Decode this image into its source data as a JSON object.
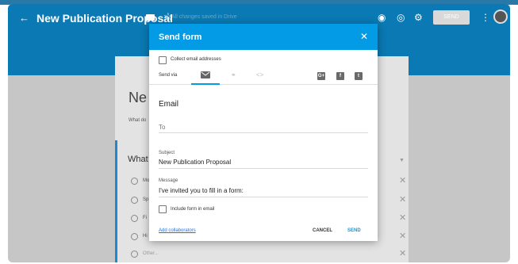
{
  "app": {
    "title": "New Publication Proposal",
    "save_status": "All changes saved in Drive",
    "send_button": "SEND"
  },
  "form": {
    "title": "New Publication Proposal",
    "title_visible": "Ne",
    "description_visible": "What do",
    "question_visible": "What",
    "options_visible": [
      "Mo",
      "Sp",
      "Fi",
      "Hi",
      "Other..."
    ]
  },
  "dialog": {
    "title": "Send form",
    "collect_label": "Collect email addresses",
    "send_via_label": "Send via",
    "social": [
      "G+",
      "f",
      "t"
    ],
    "section_title": "Email",
    "to_placeholder": "To",
    "subject_label": "Subject",
    "subject_value": "New Publication Proposal",
    "message_label": "Message",
    "message_value": "I've invited you to fill in a form:",
    "include_label": "Include form in email",
    "add_collaborators": "Add collaborators",
    "cancel": "CANCEL",
    "send": "SEND"
  },
  "colors": {
    "appbar": "#0b79b3",
    "dialog_header": "#039be5",
    "link": "#1a73e8"
  }
}
